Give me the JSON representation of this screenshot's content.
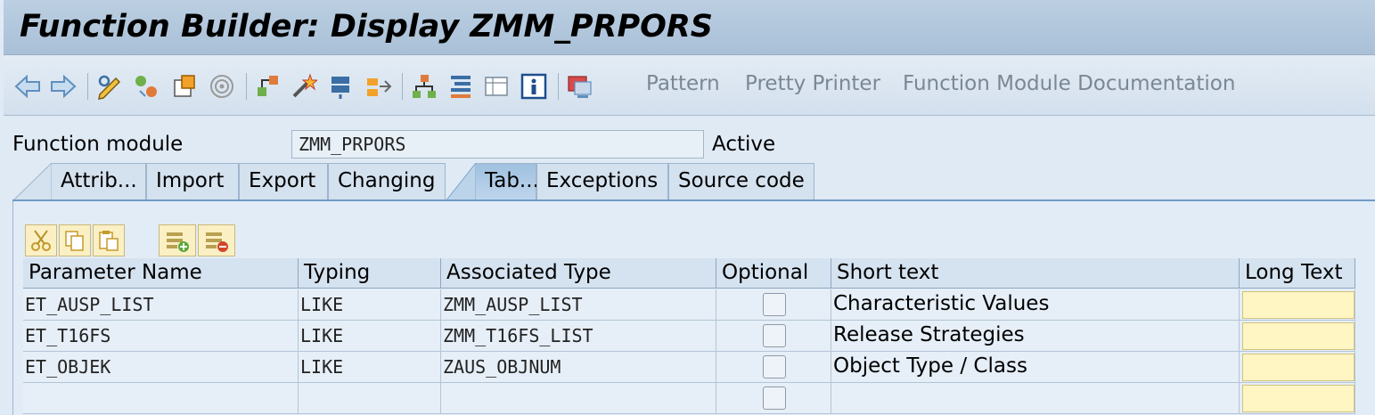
{
  "window": {
    "title": "Function Builder: Display ZMM_PRPORS"
  },
  "toolbar": {
    "icons": [
      "back-arrow-icon",
      "forward-arrow-icon",
      "display-change-icon",
      "check-icon",
      "activate-icon",
      "test-icon",
      "where-used-icon",
      "info-object-icon",
      "export-icon",
      "hierarchy-icon",
      "stack-icon",
      "list-icon",
      "info-icon",
      "display-object-list-icon"
    ],
    "pattern_label": "Pattern",
    "pretty_printer_label": "Pretty Printer",
    "fm_doc_label": "Function Module Documentation"
  },
  "header": {
    "function_module_label": "Function module",
    "function_module_value": "ZMM_PRPORS",
    "status": "Active"
  },
  "tabs": [
    {
      "label": "Attrib...",
      "active": false
    },
    {
      "label": "Import",
      "active": false
    },
    {
      "label": "Export",
      "active": false
    },
    {
      "label": "Changing",
      "active": false
    },
    {
      "label": "Tab...",
      "active": true
    },
    {
      "label": "Exceptions",
      "active": false
    },
    {
      "label": "Source code",
      "active": false
    }
  ],
  "table_toolbar": {
    "icons": [
      "cut-icon",
      "copy-icon",
      "paste-icon",
      "insert-row-icon",
      "delete-row-icon"
    ]
  },
  "table": {
    "columns": [
      "Parameter Name",
      "Typing",
      "Associated Type",
      "Optional",
      "Short text",
      "Long Text"
    ],
    "rows": [
      {
        "name": "ET_AUSP_LIST",
        "typing": "LIKE",
        "assoc": "ZMM_AUSP_LIST",
        "optional": false,
        "short": "Characteristic Values"
      },
      {
        "name": "ET_T16FS",
        "typing": "LIKE",
        "assoc": "ZMM_T16FS_LIST",
        "optional": false,
        "short": "Release Strategies"
      },
      {
        "name": "ET_OBJEK",
        "typing": "LIKE",
        "assoc": "ZAUS_OBJNUM",
        "optional": false,
        "short": "Object Type / Class"
      },
      {
        "name": "",
        "typing": "",
        "assoc": "",
        "optional": false,
        "short": ""
      }
    ]
  },
  "colors": {
    "accent": "#6f9bc6",
    "long_text_bg": "#fff6c4"
  }
}
